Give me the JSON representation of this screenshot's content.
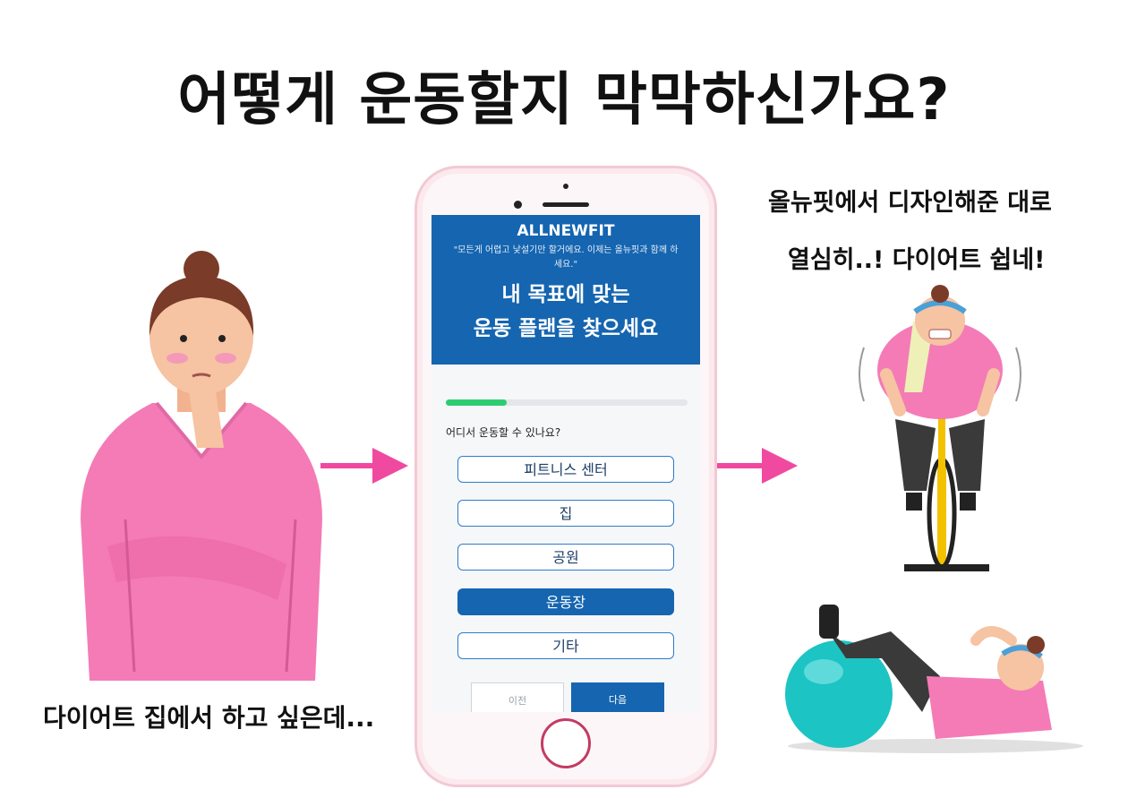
{
  "headline": "어떻게 운동할지 막막하신가요?",
  "captions": {
    "left": "다이어트 집에서 하고 싶은데...",
    "right_line1": "올뉴핏에서 디자인해준 대로",
    "right_line2": "열심히..! 다이어트 쉽네!"
  },
  "app": {
    "brand": "ALLNEWFIT",
    "quote": "\"모든게 어렵고 낯설기만 할거에요. 이제는 올뉴핏과 함께 하세요.\"",
    "title_line1": "내 목표에 맞는",
    "title_line2": "운동 플랜을 찾으세요",
    "progress_fraction": 0.25,
    "question": "어디서 운동할 수 있나요?",
    "options": [
      "피트니스 센터",
      "집",
      "공원",
      "운동장",
      "기타"
    ],
    "selected_option": "운동장",
    "prev_label": "이전",
    "next_label": "다음"
  },
  "colors": {
    "brand_blue": "#1565b0",
    "arrow_pink": "#f04aa0",
    "progress_green": "#2ecc71",
    "shirt_pink": "#f47bb6"
  }
}
